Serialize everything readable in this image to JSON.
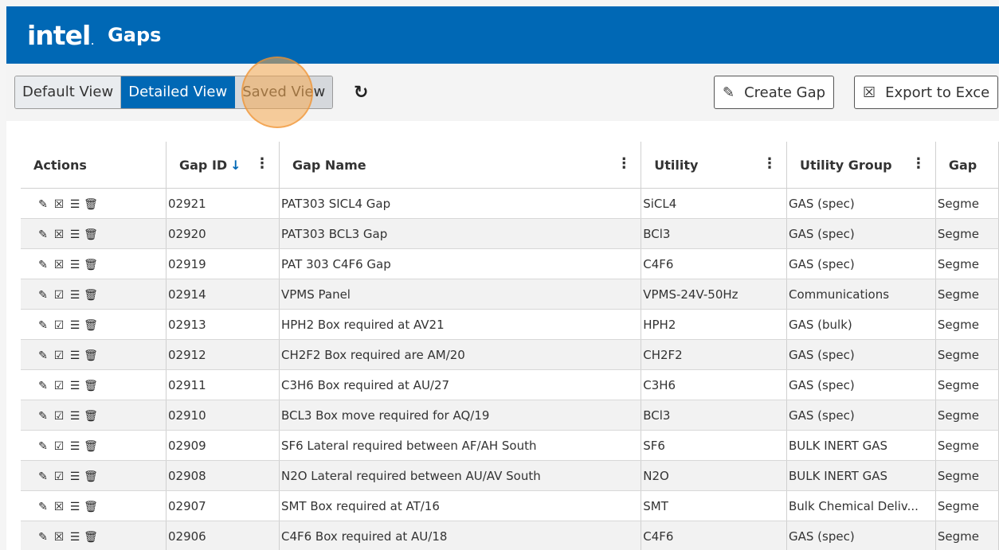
{
  "app": {
    "logo": "intel",
    "title": "Gaps"
  },
  "toolbar": {
    "views": [
      "Default View",
      "Detailed View",
      "Saved View"
    ],
    "active_view": "Detailed View",
    "create_label": "Create Gap",
    "export_label": "Export to Exce"
  },
  "table": {
    "headers": {
      "actions": "Actions",
      "gap_id": "Gap ID",
      "gap_name": "Gap Name",
      "utility": "Utility",
      "utility_group": "Utility Group",
      "gap_extra": "Gap"
    },
    "rows": [
      {
        "id": "02921",
        "name": "PAT303 SICL4 Gap",
        "utility": "SiCL4",
        "group": "GAS (spec)",
        "segment": "Segme",
        "status": "x"
      },
      {
        "id": "02920",
        "name": "PAT303 BCL3 Gap",
        "utility": "BCl3",
        "group": "GAS (spec)",
        "segment": "Segme",
        "status": "x"
      },
      {
        "id": "02919",
        "name": "PAT 303 C4F6 Gap",
        "utility": "C4F6",
        "group": "GAS (spec)",
        "segment": "Segme",
        "status": "x"
      },
      {
        "id": "02914",
        "name": "VPMS Panel",
        "utility": "VPMS-24V-50Hz",
        "group": "Communications",
        "segment": "Segme",
        "status": "check"
      },
      {
        "id": "02913",
        "name": "HPH2 Box required at AV21",
        "utility": "HPH2",
        "group": "GAS (bulk)",
        "segment": "Segme",
        "status": "check"
      },
      {
        "id": "02912",
        "name": "CH2F2 Box required are AM/20",
        "utility": "CH2F2",
        "group": "GAS (spec)",
        "segment": "Segme",
        "status": "check"
      },
      {
        "id": "02911",
        "name": "C3H6 Box required at AU/27",
        "utility": "C3H6",
        "group": "GAS (spec)",
        "segment": "Segme",
        "status": "check"
      },
      {
        "id": "02910",
        "name": "BCL3 Box move required for AQ/19",
        "utility": "BCl3",
        "group": "GAS (spec)",
        "segment": "Segme",
        "status": "check"
      },
      {
        "id": "02909",
        "name": "SF6 Lateral required between AF/AH South",
        "utility": "SF6",
        "group": "BULK INERT GAS",
        "segment": "Segme",
        "status": "check"
      },
      {
        "id": "02908",
        "name": "N2O Lateral required between AU/AV South",
        "utility": "N2O",
        "group": "BULK INERT GAS",
        "segment": "Segme",
        "status": "check"
      },
      {
        "id": "02907",
        "name": "SMT Box required at AT/16",
        "utility": "SMT",
        "group": "Bulk Chemical Deliv...",
        "segment": "Segme",
        "status": "x"
      },
      {
        "id": "02906",
        "name": "C4F6 Box required at AU/18",
        "utility": "C4F6",
        "group": "GAS (spec)",
        "segment": "Segme",
        "status": "x"
      }
    ]
  },
  "colors": {
    "brand": "#0068b5",
    "highlight": "#f6aa50"
  }
}
